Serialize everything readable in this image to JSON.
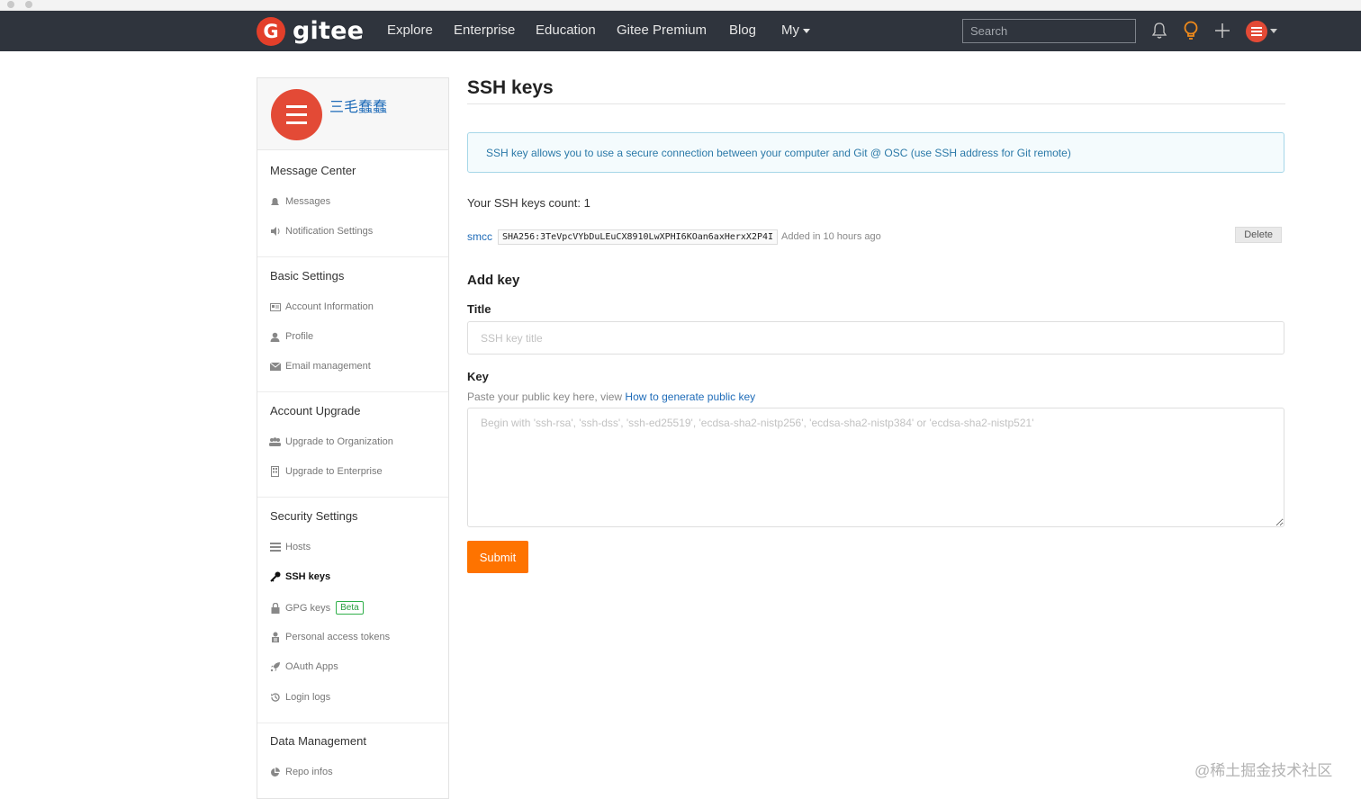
{
  "navbar": {
    "logo_letter": "G",
    "logo_text": "gitee",
    "links": [
      "Explore",
      "Enterprise",
      "Education",
      "Gitee Premium",
      "Blog",
      "My"
    ],
    "search_placeholder": "Search",
    "accent": "#e33f2a"
  },
  "sidebar": {
    "user_name": "三毛蠢蠢",
    "sections": [
      {
        "title": "Message Center",
        "items": [
          {
            "label": "Messages",
            "icon": "bell-icon"
          },
          {
            "label": "Notification Settings",
            "icon": "speaker-icon"
          }
        ]
      },
      {
        "title": "Basic Settings",
        "items": [
          {
            "label": "Account Information",
            "icon": "id-card-icon"
          },
          {
            "label": "Profile",
            "icon": "user-icon"
          },
          {
            "label": "Email management",
            "icon": "envelope-icon"
          }
        ]
      },
      {
        "title": "Account Upgrade",
        "items": [
          {
            "label": "Upgrade to Organization",
            "icon": "group-icon"
          },
          {
            "label": "Upgrade to Enterprise",
            "icon": "building-icon"
          }
        ]
      },
      {
        "title": "Security Settings",
        "items": [
          {
            "label": "Hosts",
            "icon": "list-icon"
          },
          {
            "label": "SSH keys",
            "icon": "key-icon",
            "active": true
          },
          {
            "label": "GPG keys",
            "icon": "lock-icon",
            "badge": "Beta"
          },
          {
            "label": "Personal access tokens",
            "icon": "token-icon"
          },
          {
            "label": "OAuth Apps",
            "icon": "rocket-icon"
          },
          {
            "label": "Login logs",
            "icon": "history-icon"
          }
        ]
      },
      {
        "title": "Data Management",
        "items": [
          {
            "label": "Repo infos",
            "icon": "pie-chart-icon"
          }
        ]
      }
    ]
  },
  "main": {
    "title": "SSH keys",
    "info": "SSH key allows you to use a secure connection between your computer and Git @ OSC (use SSH address for Git remote)",
    "key_count_text": "Your SSH keys count: 1",
    "keys": [
      {
        "name": "smcc",
        "fingerprint": "SHA256:3TeVpcVYbDuLEuCX8910LwXPHI6KOan6axHerxX2P4I",
        "added": "Added in 10 hours ago",
        "delete_label": "Delete"
      }
    ],
    "add_key_heading": "Add key",
    "title_label": "Title",
    "title_placeholder": "SSH key title",
    "key_label": "Key",
    "key_help_prefix": "Paste your public key here, view ",
    "key_help_link": "How to generate public key",
    "key_placeholder": "Begin with 'ssh-rsa', 'ssh-dss', 'ssh-ed25519', 'ecdsa-sha2-nistp256', 'ecdsa-sha2-nistp384' or 'ecdsa-sha2-nistp521'",
    "submit_label": "Submit",
    "submit_color": "#fe7300"
  },
  "watermark": "@稀土掘金技术社区"
}
